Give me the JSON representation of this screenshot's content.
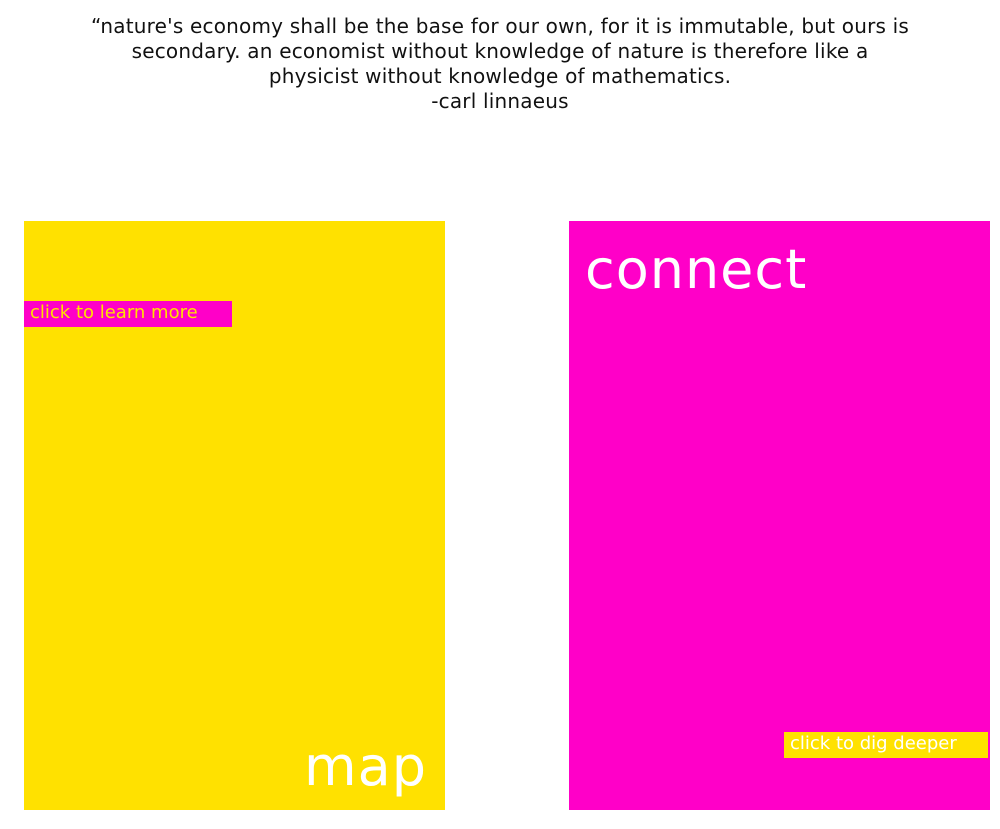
{
  "quote": {
    "lines": [
      "“nature's economy shall be the base for our own, for it is immutable, but ours is",
      "secondary. an economist without knowledge of nature is therefore like a",
      "physicist without knowledge of mathematics.",
      "-carl linnaeus"
    ]
  },
  "cards": {
    "map": {
      "title": "map",
      "link_label": "click to learn more",
      "background_color": "#FFE100",
      "link_bg_color": "#FF00C8",
      "link_text_color": "#FFE100"
    },
    "connect": {
      "title": "connect",
      "link_label": "click to dig deeper",
      "background_color": "#FF00C8",
      "link_bg_color": "#FFE100",
      "link_text_color": "#FFFFFF"
    }
  }
}
